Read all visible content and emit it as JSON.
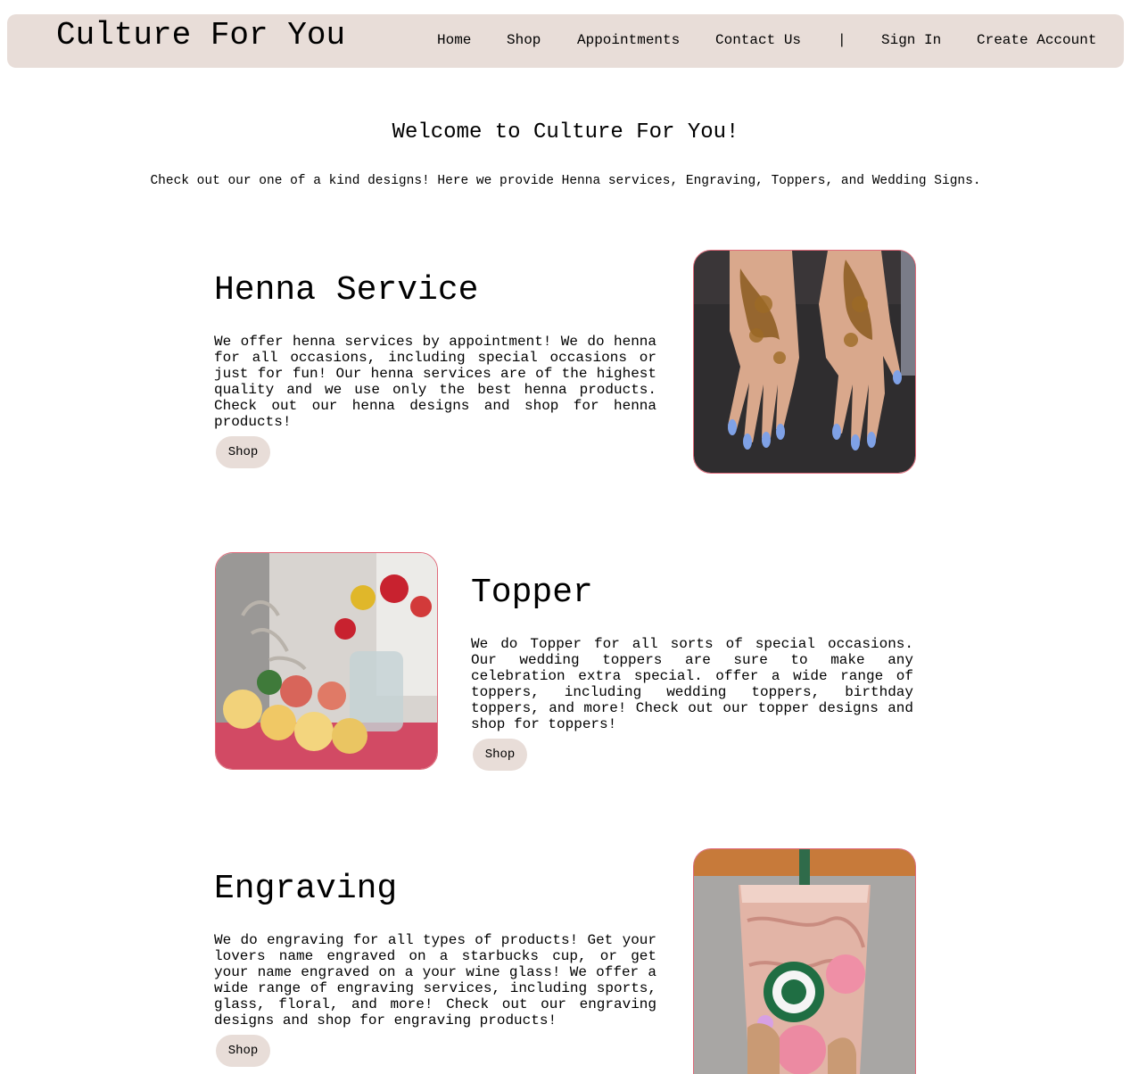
{
  "header": {
    "brand": "Culture For You",
    "nav": {
      "home": "Home",
      "shop": "Shop",
      "appointments": "Appointments",
      "contact": "Contact Us",
      "divider": "|",
      "sign_in": "Sign In",
      "create_account": "Create Account"
    }
  },
  "hero": {
    "title": "Welcome to Culture For You!",
    "subtitle": "Check out our one of a kind designs! Here we provide Henna services, Engraving, Toppers, and Wedding Signs."
  },
  "sections": {
    "henna": {
      "title": "Henna Service",
      "text": "We offer henna services by appointment! We do henna for all occasions, including special occasions or just for fun! Our henna services are of the highest quality and we use only the best henna products. Check out our henna designs and shop for henna products!",
      "button": "Shop"
    },
    "topper": {
      "title": "Topper",
      "text": "We do Topper for all sorts of special occasions. Our wedding toppers are sure to make any celebration extra special. offer a wide range of toppers, including wedding toppers, birthday toppers, and more! Check out our topper designs and shop for toppers!",
      "button": "Shop"
    },
    "engraving": {
      "title": "Engraving",
      "text": "We do engraving for all types of products! Get your lovers name engraved on a starbucks cup, or get your name engraved on a your wine glass! We offer a wide range of engraving services, including sports, glass, floral, and more! Check out our engraving designs and shop for engraving products!",
      "button": "Shop"
    }
  },
  "colors": {
    "nav_bg": "#e8ddd8",
    "photo_border": "#e06a7a"
  }
}
